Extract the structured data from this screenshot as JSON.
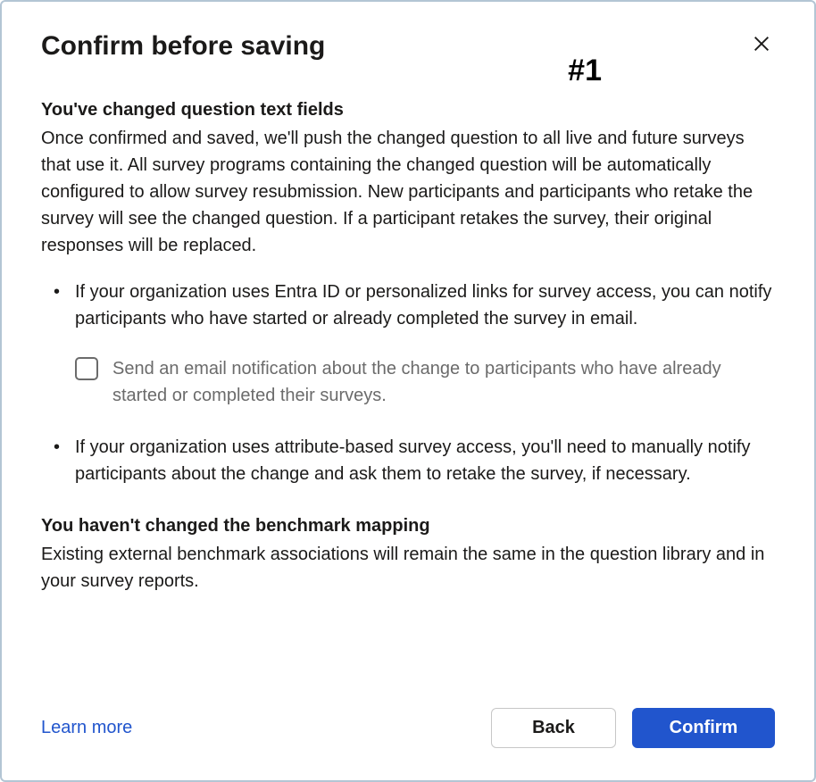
{
  "dialog": {
    "title": "Confirm before saving",
    "annotation": "#1",
    "section1": {
      "heading": "You've changed question text fields",
      "text": "Once confirmed and saved, we'll push the changed question to all live and future surveys that use it. All survey programs containing the changed question will be automatically configured to allow survey resubmission. New participants and participants who retake the survey will see the changed question. If a participant retakes the survey, their original responses will be replaced.",
      "bullet1": "If your organization uses Entra ID or personalized links for survey access, you can notify participants who have started or already completed the survey in email.",
      "checkbox_label": "Send an email notification about the change to participants who have already started or completed their surveys.",
      "bullet2": "If your organization uses attribute-based survey access, you'll need to manually notify participants about the change and ask them to retake the survey, if necessary."
    },
    "section2": {
      "heading": "You haven't changed the benchmark mapping",
      "text": "Existing external benchmark associations will remain the same in the question library and in your survey reports."
    },
    "footer": {
      "learn_more": "Learn more",
      "back": "Back",
      "confirm": "Confirm"
    }
  }
}
